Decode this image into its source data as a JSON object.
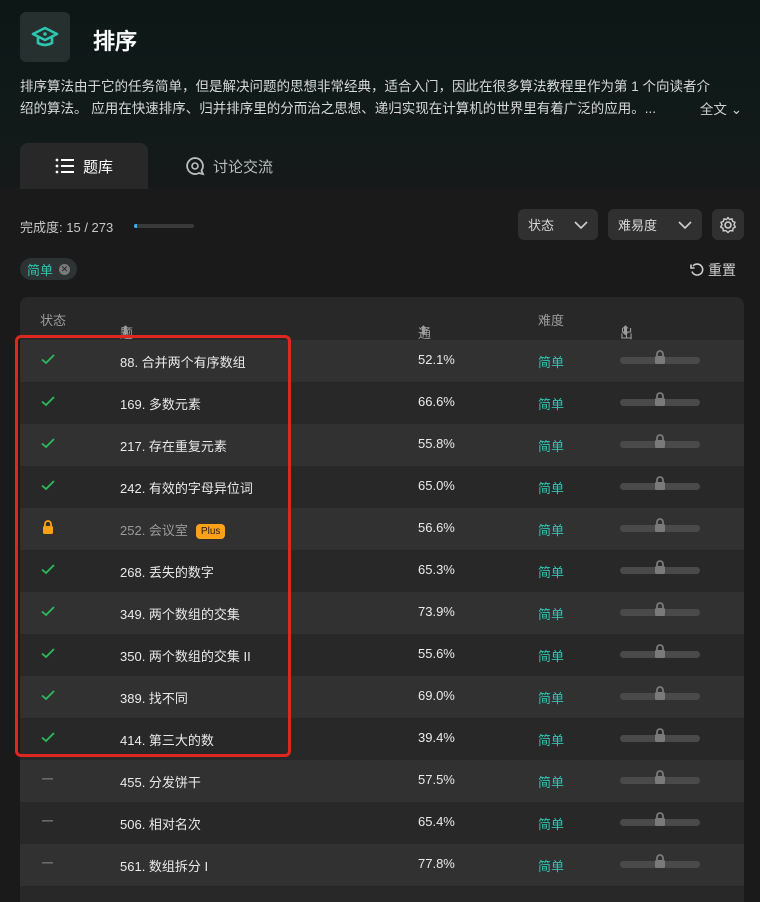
{
  "page": {
    "title": "排序",
    "description_line1": "排序算法由于它的任务简单，但是解决问题的思想非常经典，适合入门，因此在很多算法教程里作为第 1 个向读者介",
    "description_line2": "绍的算法。 应用在快速排序、归并排序里的分而治之思想、递归实现在计算机的世界里有着广泛的应用。...",
    "more_label": "全文"
  },
  "tabs": [
    {
      "label": "题库",
      "active": true
    },
    {
      "label": "讨论交流",
      "active": false
    }
  ],
  "progress": {
    "label": "完成度:",
    "value": "15 / 273",
    "fraction": 0.055
  },
  "filters": {
    "status_label": "状态",
    "difficulty_label": "难易度",
    "active_tag": "简单",
    "reset_label": "重置"
  },
  "table": {
    "headers": {
      "status": "状态",
      "title": "题目",
      "rate": "通过率",
      "difficulty": "难度",
      "frequency": "出现频率"
    },
    "rows": [
      {
        "status": "solved",
        "title": "88. 合并两个有序数组",
        "rate": "52.1%",
        "difficulty": "简单"
      },
      {
        "status": "solved",
        "title": "169. 多数元素",
        "rate": "66.6%",
        "difficulty": "简单"
      },
      {
        "status": "solved",
        "title": "217. 存在重复元素",
        "rate": "55.8%",
        "difficulty": "简单"
      },
      {
        "status": "solved",
        "title": "242. 有效的字母异位词",
        "rate": "65.0%",
        "difficulty": "简单"
      },
      {
        "status": "locked",
        "title": "252. 会议室",
        "badge": "Plus",
        "rate": "56.6%",
        "difficulty": "简单"
      },
      {
        "status": "solved",
        "title": "268. 丢失的数字",
        "rate": "65.3%",
        "difficulty": "简单"
      },
      {
        "status": "solved",
        "title": "349. 两个数组的交集",
        "rate": "73.9%",
        "difficulty": "简单"
      },
      {
        "status": "solved",
        "title": "350. 两个数组的交集 II",
        "rate": "55.6%",
        "difficulty": "简单"
      },
      {
        "status": "solved",
        "title": "389. 找不同",
        "rate": "69.0%",
        "difficulty": "简单"
      },
      {
        "status": "solved",
        "title": "414. 第三大的数",
        "rate": "39.4%",
        "difficulty": "简单"
      },
      {
        "status": "none",
        "title": "455. 分发饼干",
        "rate": "57.5%",
        "difficulty": "简单"
      },
      {
        "status": "none",
        "title": "506. 相对名次",
        "rate": "65.4%",
        "difficulty": "简单"
      },
      {
        "status": "none",
        "title": "561. 数组拆分 I",
        "rate": "77.8%",
        "difficulty": "简单"
      }
    ]
  },
  "colors": {
    "accent": "#2dc5b0",
    "solved": "#2cbb5d",
    "locked": "#ffa116",
    "highlight": "#e0271f"
  },
  "icons": {
    "logo": "graduation-cap-icon",
    "list_tab": "list-icon",
    "discuss_tab": "chat-search-icon",
    "settings": "gear-icon",
    "reset": "refresh-icon"
  }
}
